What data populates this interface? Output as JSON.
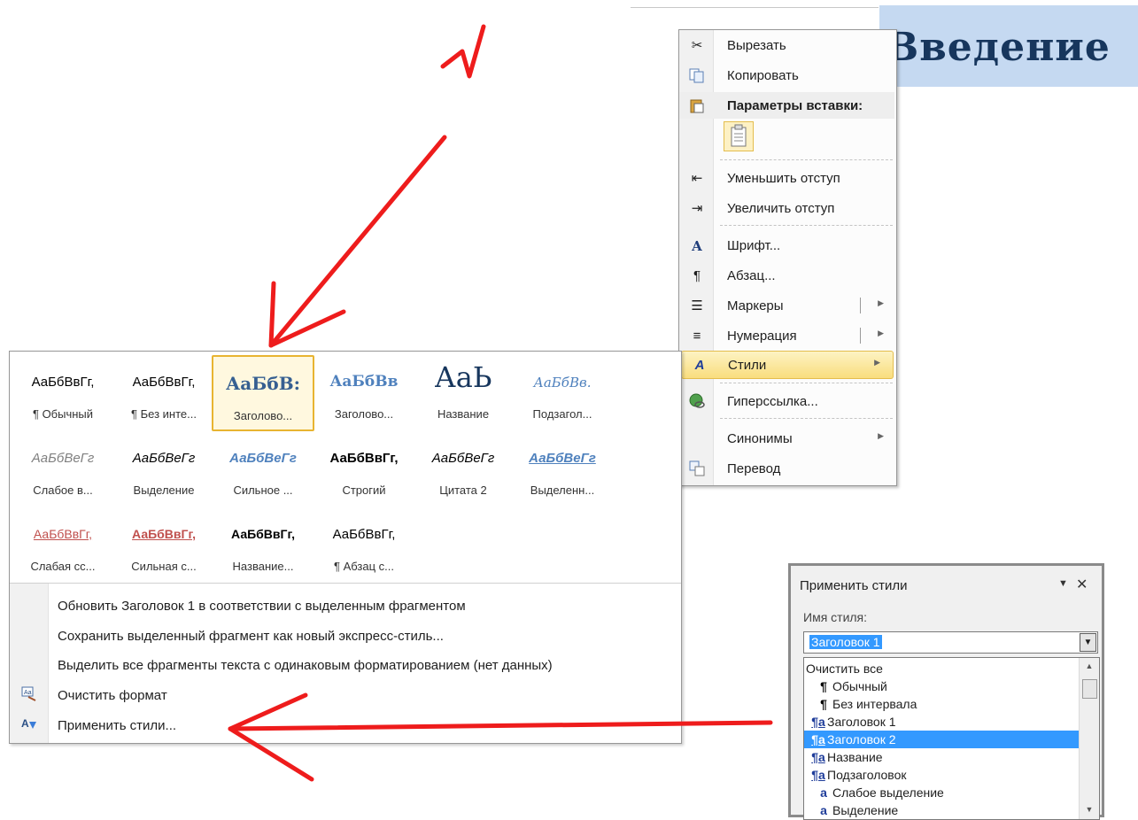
{
  "document": {
    "heading": "Введение"
  },
  "context_menu": {
    "items": [
      {
        "label": "Вырезать",
        "icon": "cut-icon"
      },
      {
        "label": "Копировать",
        "icon": "copy-icon"
      },
      {
        "label": "Параметры вставки:",
        "icon": "paste-icon"
      },
      {
        "label": "Уменьшить отступ",
        "icon": "decrease-indent-icon"
      },
      {
        "label": "Увеличить отступ",
        "icon": "increase-indent-icon"
      },
      {
        "label": "Шрифт...",
        "icon": "font-icon"
      },
      {
        "label": "Абзац...",
        "icon": "paragraph-icon"
      },
      {
        "label": "Маркеры",
        "icon": "bullets-icon"
      },
      {
        "label": "Нумерация",
        "icon": "numbering-icon"
      },
      {
        "label": "Стили",
        "icon": "styles-icon"
      },
      {
        "label": "Гиперссылка...",
        "icon": "hyperlink-icon"
      },
      {
        "label": "Синонимы",
        "icon": ""
      },
      {
        "label": "Перевод",
        "icon": "translate-icon"
      }
    ]
  },
  "styles_gallery": {
    "tiles": [
      {
        "sample": "АаБбВвГг,",
        "name": "¶ Обычный"
      },
      {
        "sample": "АаБбВвГг,",
        "name": "¶ Без инте..."
      },
      {
        "sample": "АаБбВ:",
        "name": "Заголово..."
      },
      {
        "sample": "АаБбВв",
        "name": "Заголово..."
      },
      {
        "sample": "АаЬ",
        "name": "Название"
      },
      {
        "sample": "АаБбВв.",
        "name": "Подзагол..."
      },
      {
        "sample": "АаБбВеГг",
        "name": "Слабое в..."
      },
      {
        "sample": "АаБбВеГг",
        "name": "Выделение"
      },
      {
        "sample": "АаБбВеГг",
        "name": "Сильное ..."
      },
      {
        "sample": "АаБбВвГг,",
        "name": "Строгий"
      },
      {
        "sample": "АаБбВеГг",
        "name": "Цитата 2"
      },
      {
        "sample": "АаБбВеГг",
        "name": "Выделенн..."
      },
      {
        "sample": "АаБбВвГг,",
        "name": "Слабая сс..."
      },
      {
        "sample": "АаБбВвГг,",
        "name": "Сильная с..."
      },
      {
        "sample": "АаБбВвГг,",
        "name": "Название..."
      },
      {
        "sample": "АаБбВвГг,",
        "name": "¶ Абзац с..."
      }
    ],
    "commands": [
      {
        "label": "Обновить Заголовок 1 в соответствии с выделенным фрагментом",
        "icon": ""
      },
      {
        "label": "Сохранить выделенный фрагмент как новый экспресс-стиль...",
        "icon": ""
      },
      {
        "label": "Выделить все фрагменты текста с одинаковым форматированием (нет данных)",
        "icon": ""
      },
      {
        "label": "Очистить формат",
        "icon": "clear-format-icon"
      },
      {
        "label": "Применить стили...",
        "icon": "apply-styles-icon"
      }
    ]
  },
  "apply_styles_pane": {
    "title": "Применить стили",
    "field_label": "Имя стиля:",
    "current_value": "Заголовок 1",
    "list": [
      {
        "glyph": "",
        "label": "Очистить все"
      },
      {
        "glyph": "¶",
        "label": "Обычный"
      },
      {
        "glyph": "¶",
        "label": "Без интервала"
      },
      {
        "glyph": "¶a",
        "label": "Заголовок 1"
      },
      {
        "glyph": "¶a",
        "label": "Заголовок 2"
      },
      {
        "glyph": "¶a",
        "label": "Название"
      },
      {
        "glyph": "¶a",
        "label": "Подзаголовок"
      },
      {
        "glyph": "a",
        "label": "Слабое выделение"
      },
      {
        "glyph": "a",
        "label": "Выделение"
      }
    ]
  },
  "annotation": {
    "number": "1",
    "color": "#ee1c1c"
  },
  "colors": {
    "accent": "#3399ff",
    "selection_gold": "#e8b431"
  }
}
